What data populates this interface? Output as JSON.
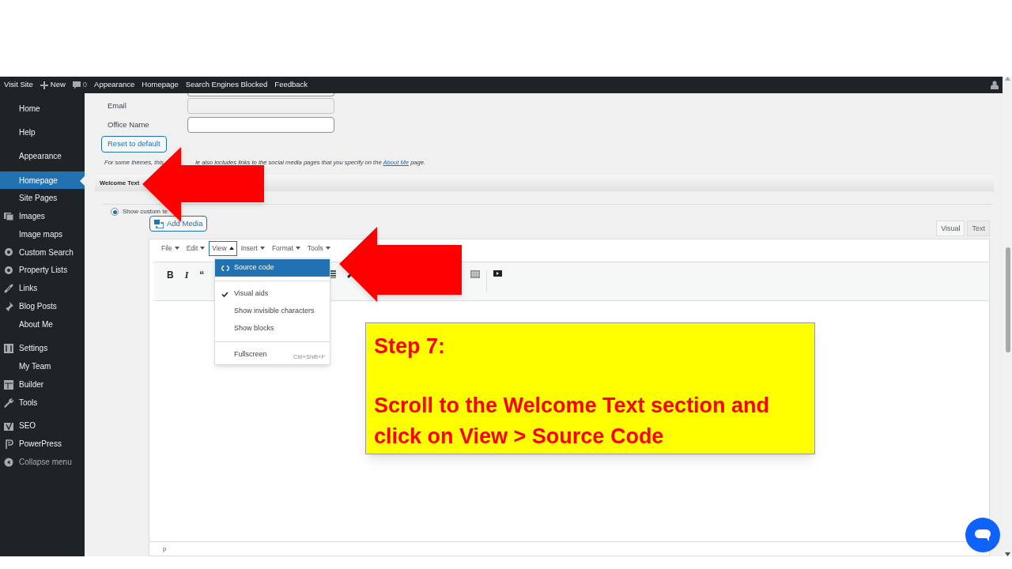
{
  "admin_bar": {
    "items": [
      {
        "kind": "link",
        "label": "Visit Site"
      },
      {
        "kind": "new",
        "label": "New"
      },
      {
        "kind": "comments",
        "label": "0"
      },
      {
        "kind": "link",
        "label": "Appearance"
      },
      {
        "kind": "link",
        "label": "Homepage"
      },
      {
        "kind": "link",
        "label": "Search Engines Blocked"
      },
      {
        "kind": "link",
        "label": "Feedback"
      }
    ]
  },
  "sidebar": {
    "items": [
      {
        "kind": "sub",
        "label": "Home",
        "selected": false
      },
      {
        "kind": "sub",
        "label": "Help",
        "selected": false
      },
      {
        "kind": "sub",
        "label": "Appearance",
        "selected": false
      },
      {
        "kind": "sub",
        "label": "Homepage",
        "selected": true
      },
      {
        "kind": "sub",
        "label": "Site Pages",
        "selected": false
      },
      {
        "kind": "top",
        "label": "Images",
        "selected": false
      },
      {
        "kind": "sub",
        "label": "Image maps",
        "selected": false
      },
      {
        "kind": "top",
        "label": "Custom Search",
        "selected": false
      },
      {
        "kind": "top",
        "label": "Property Lists",
        "selected": false
      },
      {
        "kind": "top",
        "label": "Links",
        "selected": false
      },
      {
        "kind": "top",
        "label": "Blog Posts",
        "selected": false
      },
      {
        "kind": "sub",
        "label": "About Me",
        "selected": false
      },
      {
        "kind": "top",
        "label": "Settings",
        "selected": false
      },
      {
        "kind": "sub",
        "label": "My Team",
        "selected": false
      },
      {
        "kind": "top",
        "label": "Builder",
        "selected": false
      },
      {
        "kind": "top",
        "label": "Tools",
        "selected": false
      },
      {
        "kind": "top",
        "label": "SEO",
        "selected": false
      },
      {
        "kind": "top",
        "label": "PowerPress",
        "selected": false
      }
    ],
    "collapse": "Collapse menu"
  },
  "form": {
    "fields": [
      {
        "label": "Email",
        "disabled": true
      },
      {
        "label": "Office Name",
        "disabled": false
      }
    ],
    "reset_button": "Reset to default",
    "note_start": "For some themes, this",
    "note_rest": "le also includes links to the social media pages that you specify on the",
    "note_link": "About Me",
    "note_end": "page."
  },
  "section": {
    "title": "Welcome Text"
  },
  "radio": {
    "label": "Show custom te",
    "checked": true
  },
  "add_media": "Add Media",
  "editor_tabs": [
    {
      "label": "Visual",
      "selected": true
    },
    {
      "label": "Text",
      "selected": false
    }
  ],
  "menubar": [
    {
      "label": "File",
      "expanded": false
    },
    {
      "label": "Edit",
      "expanded": false
    },
    {
      "label": "View",
      "expanded": true
    },
    {
      "label": "Insert",
      "expanded": false
    },
    {
      "label": "Format",
      "expanded": false
    },
    {
      "label": "Tools",
      "expanded": false
    }
  ],
  "toolbar": [
    "B",
    "I",
    "“"
  ],
  "view_menu": {
    "items": [
      {
        "kind": "item",
        "label": "Source code",
        "selected": true,
        "checked": false
      },
      {
        "kind": "separator"
      },
      {
        "kind": "item",
        "label": "Visual aids",
        "selected": false,
        "checked": true
      },
      {
        "kind": "item",
        "label": "Show invisible characters",
        "selected": false,
        "checked": false
      },
      {
        "kind": "item",
        "label": "Show blocks",
        "selected": false,
        "checked": false
      },
      {
        "kind": "separator"
      },
      {
        "kind": "item",
        "label": "Fullscreen",
        "selected": false,
        "checked": false,
        "shortcut": "Ctrl+Shift+F"
      }
    ]
  },
  "status_path": "p",
  "callout": {
    "title": "Step 7:",
    "body": "Scroll to the Welcome Text section and click on View > Source Code"
  }
}
